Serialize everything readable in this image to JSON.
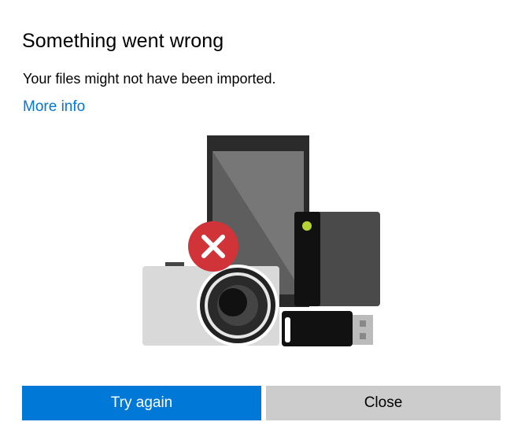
{
  "dialog": {
    "title": "Something went wrong",
    "message": "Your files might not have been imported.",
    "link_label": "More info"
  },
  "illustration": {
    "icons": [
      "tablet-icon",
      "external-drive-icon",
      "camera-icon",
      "usb-drive-icon",
      "error-icon"
    ],
    "colors": {
      "accent": "#0078d7",
      "error": "#d13438",
      "tablet": "#2b2b2b",
      "tablet_screen": "#6d6d6d",
      "drive": "#4a4a4a",
      "drive_led": "#b5d334",
      "camera_body": "#d9d9d9",
      "usb_body": "#111111"
    }
  },
  "buttons": {
    "primary_label": "Try again",
    "secondary_label": "Close"
  }
}
